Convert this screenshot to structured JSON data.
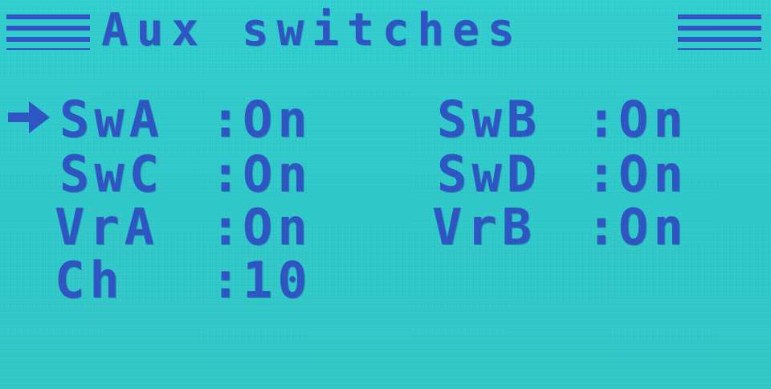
{
  "title": "Aux switches",
  "rows": [
    {
      "label": "SwA",
      "sep": ":",
      "value": "On",
      "selected": true
    },
    {
      "label": "SwB",
      "sep": ":",
      "value": "On",
      "selected": false
    },
    {
      "label": "SwC",
      "sep": ":",
      "value": "On",
      "selected": false
    },
    {
      "label": "SwD",
      "sep": ":",
      "value": "On",
      "selected": false
    },
    {
      "label": "VrA",
      "sep": ":",
      "value": "On",
      "selected": false
    },
    {
      "label": "VrB",
      "sep": ":",
      "value": "On",
      "selected": false
    },
    {
      "label": "Ch",
      "sep": ":",
      "value": "10",
      "selected": false
    }
  ],
  "colors": {
    "background": "#33cccc",
    "pixels": "#2f56c4"
  },
  "icons": {
    "cursor": "right-arrow-icon"
  }
}
